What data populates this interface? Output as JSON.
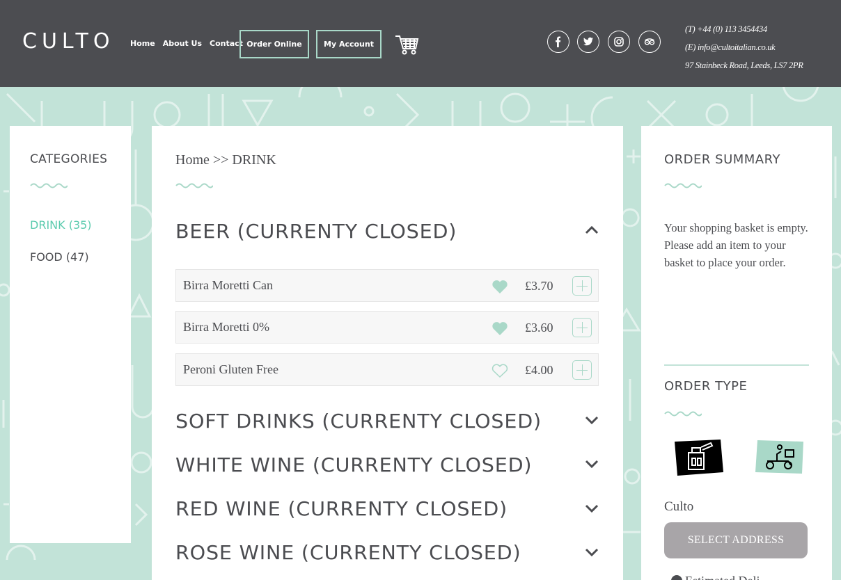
{
  "header": {
    "logo": "CULTO",
    "nav": [
      "Home",
      "About Us",
      "Contact"
    ],
    "order_online": "Order Online",
    "my_account": "My Account",
    "contact": {
      "phone": "(T) +44 (0) 113 3454434",
      "email": "(E) info@cultoitalian.co.uk",
      "address": "97 Stainbeck Road, Leeds, LS7 2PR"
    },
    "social": [
      "facebook-icon",
      "twitter-icon",
      "instagram-icon",
      "tripadvisor-icon"
    ]
  },
  "categories": {
    "title": "CATEGORIES",
    "items": [
      {
        "label": "DRINK (35)",
        "active": true
      },
      {
        "label": "FOOD (47)",
        "active": false
      }
    ]
  },
  "main": {
    "breadcrumb": "Home >> DRINK",
    "sections": [
      {
        "title": "BEER (CURRENTY CLOSED)",
        "expanded": true
      },
      {
        "title": "SOFT DRINKS (CURRENTY CLOSED)",
        "expanded": false
      },
      {
        "title": "WHITE WINE (CURRENTY CLOSED)",
        "expanded": false
      },
      {
        "title": "RED WINE (CURRENTY CLOSED)",
        "expanded": false
      },
      {
        "title": "ROSE WINE (CURRENTY CLOSED)",
        "expanded": false
      }
    ],
    "items": [
      {
        "name": "Birra Moretti Can",
        "price": "£3.70",
        "favourite": true
      },
      {
        "name": "Birra Moretti 0%",
        "price": "£3.60",
        "favourite": true
      },
      {
        "name": "Peroni Gluten Free",
        "price": "£4.00",
        "favourite": false
      }
    ]
  },
  "summary": {
    "title": "ORDER SUMMARY",
    "empty_text": "Your shopping basket is empty. Please add an item to your basket to place your order.",
    "order_type_title": "ORDER TYPE",
    "order_types": [
      "collection-icon",
      "delivery-icon"
    ],
    "restaurant": "Culto",
    "select_address": "SELECT ADDRESS",
    "estimated": "Estimated Deli"
  },
  "colors": {
    "header_bg": "#4c4d51",
    "accent": "#5ccbae",
    "mint": "#c2e3d8",
    "button_grey": "#a8a5a8"
  }
}
